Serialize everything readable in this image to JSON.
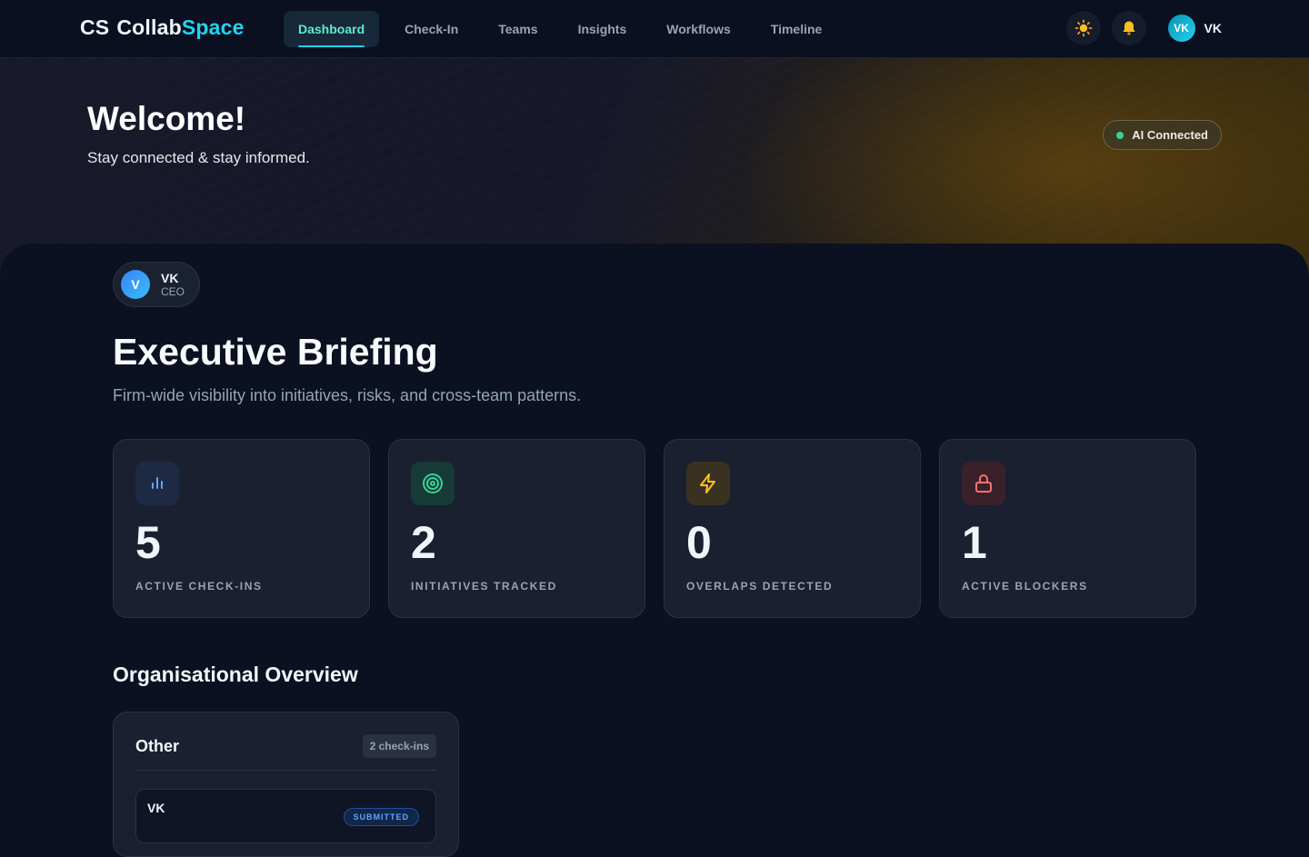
{
  "brand": {
    "mark": "CS",
    "name_a": "Collab",
    "name_b": "Space"
  },
  "nav": [
    {
      "label": "Dashboard",
      "active": true
    },
    {
      "label": "Check-In"
    },
    {
      "label": "Teams"
    },
    {
      "label": "Insights"
    },
    {
      "label": "Workflows"
    },
    {
      "label": "Timeline"
    }
  ],
  "top_actions": {
    "theme_icon": "sun-icon",
    "notification_icon": "bell-icon",
    "user_initials": "VK",
    "user_name": "VK"
  },
  "hero": {
    "title": "Welcome!",
    "subtitle": "Stay connected & stay informed.",
    "ai_status": "AI Connected"
  },
  "profile": {
    "initial": "V",
    "name": "VK",
    "role": "CEO"
  },
  "page": {
    "title": "Executive Briefing",
    "subtitle": "Firm-wide visibility into initiatives, risks, and cross-team patterns."
  },
  "stats": [
    {
      "icon": "bar-chart-icon",
      "value": "5",
      "label": "ACTIVE CHECK-INS",
      "color": "#60a5fa"
    },
    {
      "icon": "target-icon",
      "value": "2",
      "label": "INITIATIVES TRACKED",
      "color": "#34d399"
    },
    {
      "icon": "lightning-icon",
      "value": "0",
      "label": "OVERLAPS DETECTED",
      "color": "#fbbf24"
    },
    {
      "icon": "lock-icon",
      "value": "1",
      "label": "ACTIVE BLOCKERS",
      "color": "#f87171"
    }
  ],
  "overview": {
    "title": "Organisational Overview",
    "groups": [
      {
        "name": "Other",
        "count": "2 check-ins",
        "entries": [
          {
            "name": "VK",
            "status": "SUBMITTED"
          }
        ]
      }
    ]
  }
}
